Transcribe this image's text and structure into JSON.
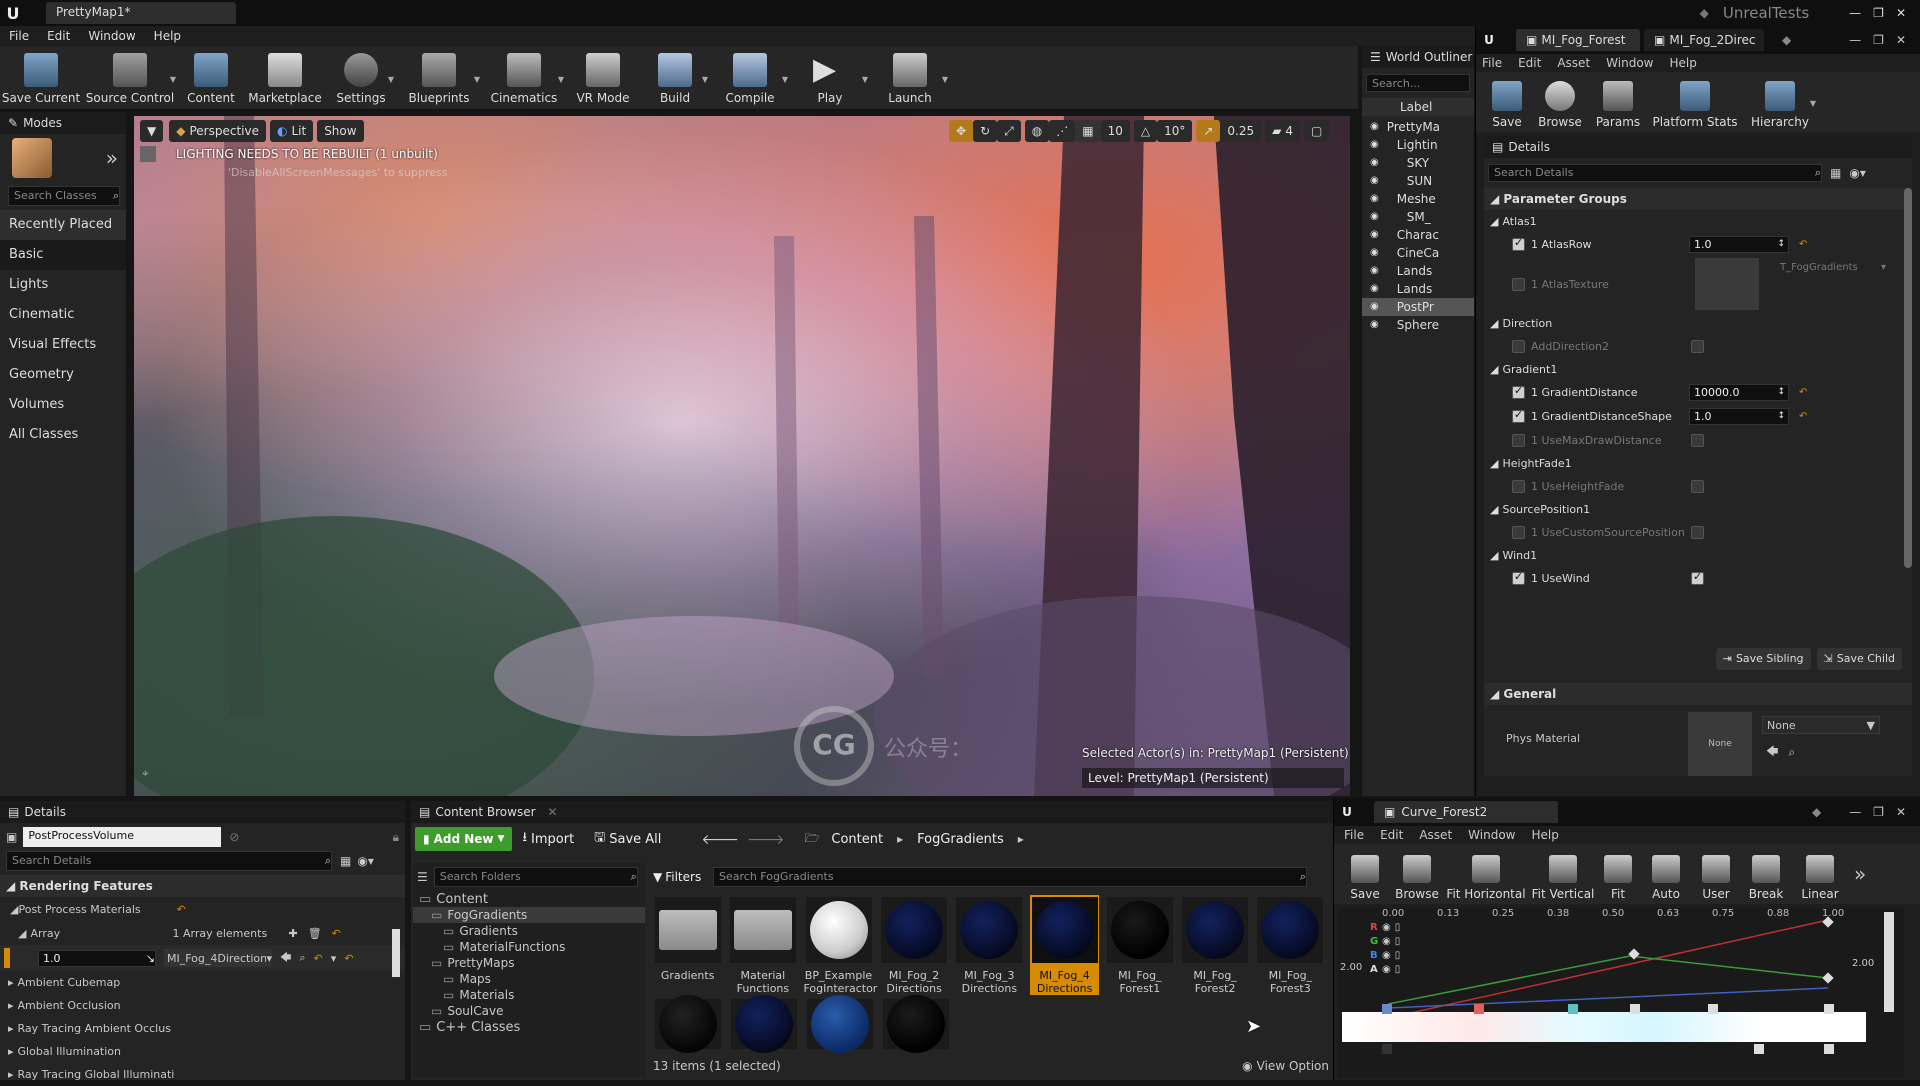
{
  "title_tab": "PrettyMap1*",
  "app_name": "UnrealTests",
  "menu": [
    "File",
    "Edit",
    "Window",
    "Help"
  ],
  "toolbar": [
    "Save Current",
    "Source Control",
    "Content",
    "Marketplace",
    "Settings",
    "Blueprints",
    "Cinematics",
    "VR Mode",
    "Build",
    "Compile",
    "Play",
    "Launch"
  ],
  "modes": {
    "title": "Modes",
    "search_placeholder": "Search Classes",
    "items": [
      "Recently Placed",
      "Basic",
      "Lights",
      "Cinematic",
      "Visual Effects",
      "Geometry",
      "Volumes",
      "All Classes"
    ]
  },
  "viewport": {
    "perspective": "Perspective",
    "lit": "Lit",
    "show": "Show",
    "warning": "LIGHTING NEEDS TO BE REBUILT (1 unbuilt)",
    "warning_sub": "'DisableAllScreenMessages' to suppress",
    "grid": "10",
    "angle": "10°",
    "scale": "0.25",
    "cam": "4",
    "selected": "Selected Actor(s) in:  PrettyMap1 (Persistent)",
    "level": "Level:  PrettyMap1 (Persistent)"
  },
  "outliner": {
    "title": "World Outliner",
    "search_placeholder": "Search...",
    "label_header": "Label",
    "rows": [
      "PrettyMa",
      "Lightin",
      "SKY",
      "SUN",
      "Meshe",
      "SM_",
      "Charac",
      "CineCa",
      "Lands",
      "Lands",
      "PostPr",
      "Sphere"
    ]
  },
  "material_editor": {
    "tabs": [
      "MI_Fog_Forest",
      "MI_Fog_2Direc"
    ],
    "menu": [
      "File",
      "Edit",
      "Asset",
      "Window",
      "Help"
    ],
    "toolbar": [
      "Save",
      "Browse",
      "Params",
      "Platform Stats",
      "Hierarchy"
    ],
    "details_title": "Details",
    "search_placeholder": "Search Details",
    "param_groups": "Parameter Groups",
    "groups": [
      {
        "name": "Atlas1",
        "params": [
          {
            "label": "1 AtlasRow",
            "checked": true,
            "value": "1.0"
          },
          {
            "label": "1 AtlasTexture",
            "checked": false,
            "value": "T_FogGradients"
          }
        ]
      },
      {
        "name": "Direction",
        "params": [
          {
            "label": "AddDirection2",
            "checked": false,
            "value": ""
          }
        ]
      },
      {
        "name": "Gradient1",
        "params": [
          {
            "label": "1 GradientDistance",
            "checked": true,
            "value": "10000.0"
          },
          {
            "label": "1 GradientDistanceShape",
            "checked": true,
            "value": "1.0"
          },
          {
            "label": "1 UseMaxDrawDistance",
            "checked": false,
            "value": ""
          }
        ]
      },
      {
        "name": "HeightFade1",
        "params": [
          {
            "label": "1 UseHeightFade",
            "checked": false,
            "value": ""
          }
        ]
      },
      {
        "name": "SourcePosition1",
        "params": [
          {
            "label": "1 UseCustomSourcePosition",
            "checked": false,
            "value": ""
          }
        ]
      },
      {
        "name": "Wind1",
        "params": [
          {
            "label": "1 UseWind",
            "checked": true,
            "value": ""
          }
        ]
      }
    ],
    "save_sibling": "Save Sibling",
    "save_child": "Save Child",
    "general": "General",
    "phys_material": "Phys Material",
    "none_thumb": "None",
    "none_select": "None"
  },
  "details": {
    "title": "Details",
    "object": "PostProcessVolume",
    "search_placeholder": "Search Details",
    "section": "Rendering Features",
    "ppm": "Post Process Materials",
    "array": "Array",
    "array_count": "1 Array elements",
    "elem_value": "1.0",
    "elem_asset": "MI_Fog_4Direction",
    "more": [
      "Ambient Cubemap",
      "Ambient Occlusion",
      "Ray Tracing Ambient Occlus",
      "Global Illumination",
      "Ray Tracing Global Illuminati"
    ]
  },
  "content_browser": {
    "title": "Content Browser",
    "add_new": "Add New",
    "import": "Import",
    "save_all": "Save All",
    "crumbs": [
      "Content",
      "FogGradients"
    ],
    "search_folders": "Search Folders",
    "filters": "Filters",
    "search_assets": "Search FogGradients",
    "tree": [
      {
        "label": "Content",
        "depth": 0
      },
      {
        "label": "FogGradients",
        "depth": 1
      },
      {
        "label": "Gradients",
        "depth": 2
      },
      {
        "label": "MaterialFunctions",
        "depth": 2
      },
      {
        "label": "PrettyMaps",
        "depth": 1
      },
      {
        "label": "Maps",
        "depth": 2
      },
      {
        "label": "Materials",
        "depth": 2
      },
      {
        "label": "SoulCave",
        "depth": 1
      },
      {
        "label": "C++ Classes",
        "depth": 0
      }
    ],
    "assets": [
      {
        "name": "Gradients",
        "kind": "folder"
      },
      {
        "name": "Material Functions",
        "kind": "folder"
      },
      {
        "name": "BP_Example FogInteractor",
        "kind": "white"
      },
      {
        "name": "MI_Fog_2 Directions",
        "kind": "sphere"
      },
      {
        "name": "MI_Fog_3 Directions",
        "kind": "sphere"
      },
      {
        "name": "MI_Fog_4 Directions",
        "kind": "sphere",
        "selected": true
      },
      {
        "name": "MI_Fog_ Forest1",
        "kind": "dark"
      },
      {
        "name": "MI_Fog_ Forest2",
        "kind": "sphere"
      },
      {
        "name": "MI_Fog_ Forest3",
        "kind": "sphere"
      }
    ],
    "status": "13 items (1 selected)",
    "view_options": "View Option"
  },
  "curve_editor": {
    "tab": "Curve_Forest2",
    "menu": [
      "File",
      "Edit",
      "Asset",
      "Window",
      "Help"
    ],
    "toolbar": [
      "Save",
      "Browse",
      "Fit Horizontal",
      "Fit Vertical",
      "Fit",
      "Auto",
      "User",
      "Break",
      "Linear"
    ],
    "ticks": [
      "0.00",
      "0.13",
      "0.25",
      "0.38",
      "0.50",
      "0.63",
      "0.75",
      "0.88",
      "1.00"
    ],
    "y_label": "2.00",
    "y_label_right": "2.00",
    "channels": [
      "R",
      "G",
      "B",
      "A"
    ]
  },
  "watermark": "公众号：",
  "colors": {
    "accent": "#f0a30a",
    "selected": "#d68b00",
    "addnew": "#3f9b2c"
  }
}
